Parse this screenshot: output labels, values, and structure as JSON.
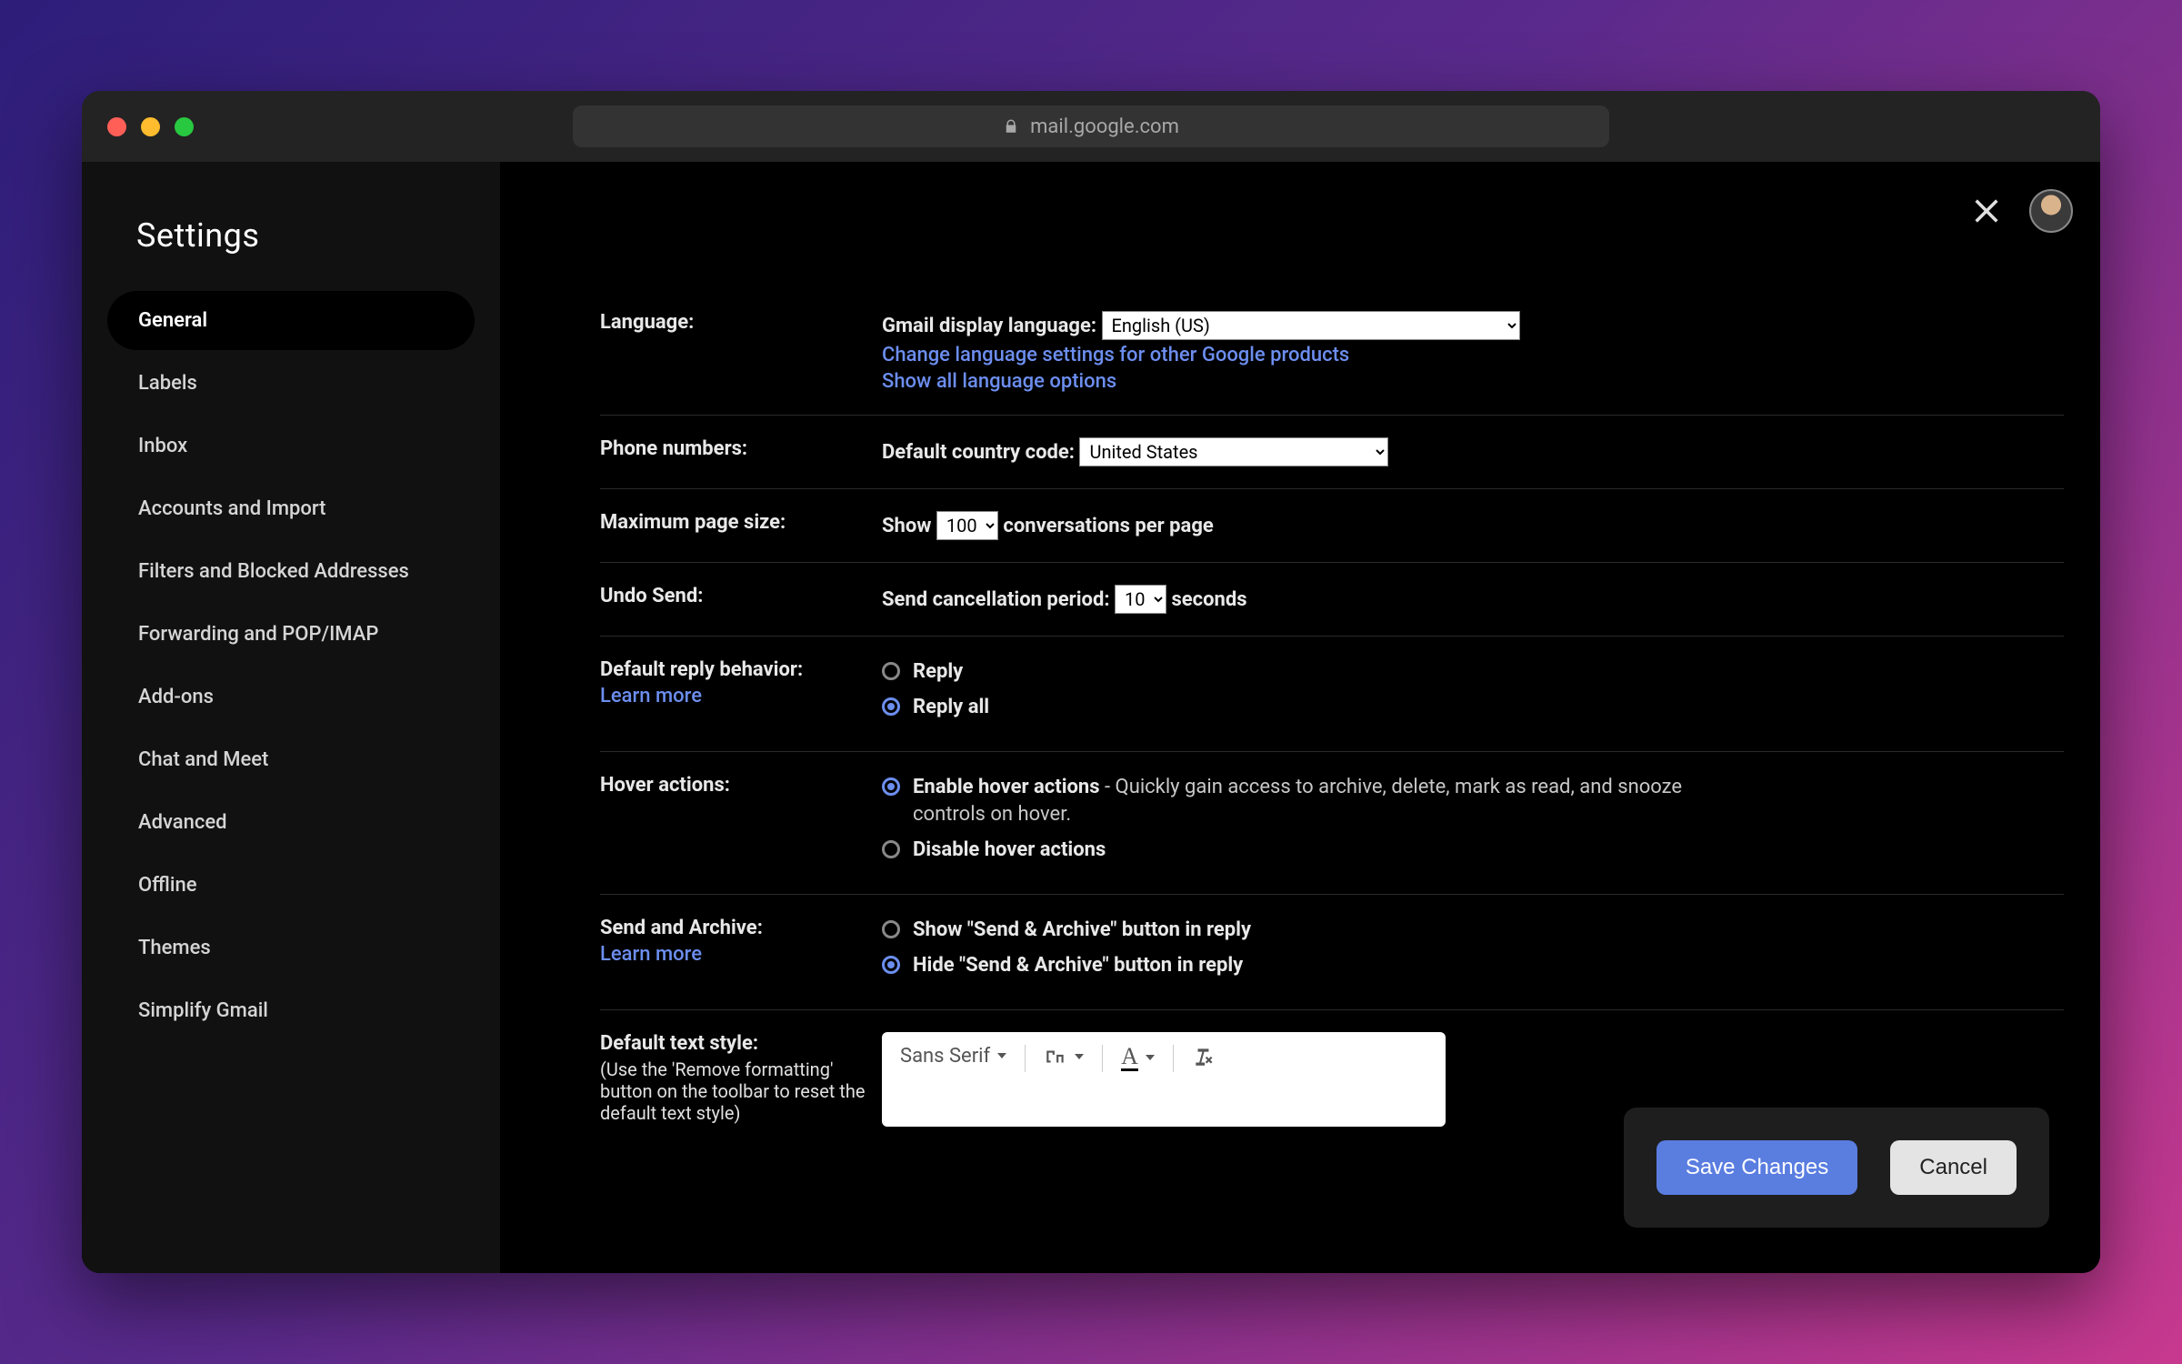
{
  "browser": {
    "url": "mail.google.com"
  },
  "sidebar": {
    "title": "Settings",
    "items": [
      "General",
      "Labels",
      "Inbox",
      "Accounts and Import",
      "Filters and Blocked Addresses",
      "Forwarding and POP/IMAP",
      "Add-ons",
      "Chat and Meet",
      "Advanced",
      "Offline",
      "Themes",
      "Simplify Gmail"
    ],
    "active_index": 0
  },
  "sections": {
    "language": {
      "label": "Language:",
      "display_label": "Gmail display language:",
      "display_value": "English (US)",
      "link1": "Change language settings for other Google products",
      "link2": "Show all language options"
    },
    "phone": {
      "label": "Phone numbers:",
      "cc_label": "Default country code:",
      "cc_value": "United States"
    },
    "pagesize": {
      "label": "Maximum page size:",
      "show": "Show",
      "value": "100",
      "suffix": "conversations per page"
    },
    "undo": {
      "label": "Undo Send:",
      "period_label": "Send cancellation period:",
      "value": "10",
      "suffix": "seconds"
    },
    "reply": {
      "label": "Default reply behavior:",
      "learn": "Learn more",
      "opt1": "Reply",
      "opt2": "Reply all",
      "selected": 1
    },
    "hover": {
      "label": "Hover actions:",
      "opt1": "Enable hover actions",
      "opt1_desc": " - Quickly gain access to archive, delete, mark as read, and snooze controls on hover.",
      "opt2": "Disable hover actions",
      "selected": 0
    },
    "sendarchive": {
      "label": "Send and Archive:",
      "learn": "Learn more",
      "opt1": "Show \"Send & Archive\" button in reply",
      "opt2": "Hide \"Send & Archive\" button in reply",
      "selected": 1
    },
    "textstyle": {
      "label": "Default text style:",
      "hint": "(Use the 'Remove formatting' button on the toolbar to reset the default text style)",
      "font": "Sans Serif"
    }
  },
  "footer": {
    "save": "Save Changes",
    "cancel": "Cancel"
  }
}
